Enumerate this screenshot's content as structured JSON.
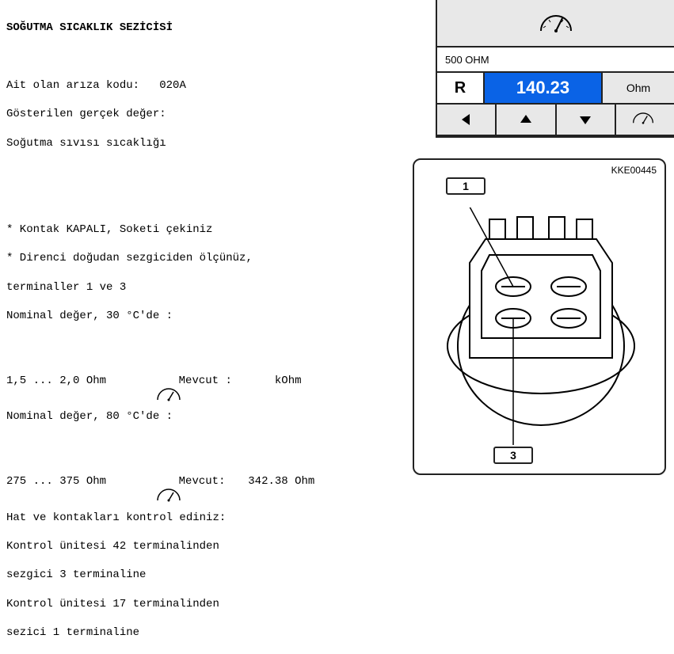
{
  "left": {
    "title": "SOĞUTMA SICAKLIK SEZİCİSİ",
    "fault_label": "Ait olan arıza kodu:",
    "fault_code": "020A",
    "shown_label": "Gösterilen gerçek değer:",
    "shown_value": "Soğutma sıvısı sıcaklığı",
    "step1": "* Kontak KAPALI, Soketi çekiniz",
    "step2": "* Direnci doğudan sezgiciden ölçünüz,",
    "step2b": "terminaller 1 ve 3",
    "nominal30_label": "Nominal değer, 30 °C'de :",
    "nominal30_range": "1,5 ... 2,0 Ohm",
    "mevcut30_label": "Mevcut :",
    "mevcut30_value": "kOhm",
    "nominal80_label": "Nominal değer, 80 °C'de :",
    "nominal80_range": "275 ... 375 Ohm",
    "mevcut80_label": "Mevcut:",
    "mevcut80_value": "342.38 Ohm",
    "check_label": "Hat ve kontakları kontrol ediniz:",
    "check1a": "Kontrol ünitesi 42 terminalinden",
    "check1b": "sezgici 3 terminaline",
    "check2a": "Kontrol ünitesi 17 terminalinden",
    "check2b": "sezici 1 terminaline"
  },
  "meter": {
    "info": "500 OHM",
    "r_label": "R",
    "value": "140.23",
    "unit": "Ohm"
  },
  "diagram": {
    "code": "KKE00445",
    "pin1": "1",
    "pin3": "3"
  }
}
